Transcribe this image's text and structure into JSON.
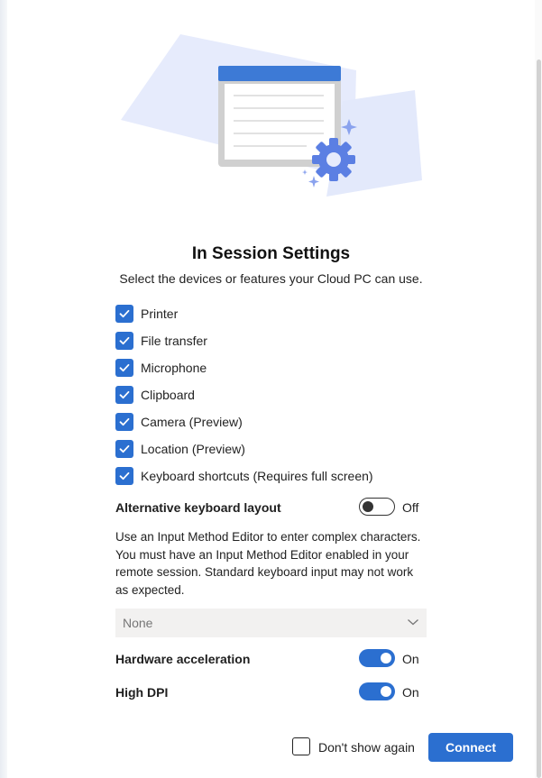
{
  "title": "In Session Settings",
  "subtitle": "Select the devices or features your Cloud PC can use.",
  "devices": [
    {
      "label": "Printer",
      "checked": true
    },
    {
      "label": "File transfer",
      "checked": true
    },
    {
      "label": "Microphone",
      "checked": true
    },
    {
      "label": "Clipboard",
      "checked": true
    },
    {
      "label": "Camera (Preview)",
      "checked": true
    },
    {
      "label": "Location (Preview)",
      "checked": true
    },
    {
      "label": "Keyboard shortcuts (Requires full screen)",
      "checked": true
    }
  ],
  "alt_keyboard": {
    "label": "Alternative keyboard layout",
    "state": "Off",
    "description": "Use an Input Method Editor to enter complex characters. You must have an Input Method Editor enabled in your remote session. Standard keyboard input may not work as expected.",
    "dropdown_value": "None"
  },
  "hardware_acceleration": {
    "label": "Hardware acceleration",
    "state": "On"
  },
  "high_dpi": {
    "label": "High DPI",
    "state": "On"
  },
  "footer": {
    "dont_show_label": "Don't show again",
    "connect_label": "Connect"
  },
  "icons": [
    "check-icon",
    "chevron-down-icon",
    "window-illustration",
    "gear-icon",
    "sparkle-icon"
  ],
  "colors": {
    "accent": "#2b6fd0",
    "illustration_bg": "#e6ebfc"
  }
}
